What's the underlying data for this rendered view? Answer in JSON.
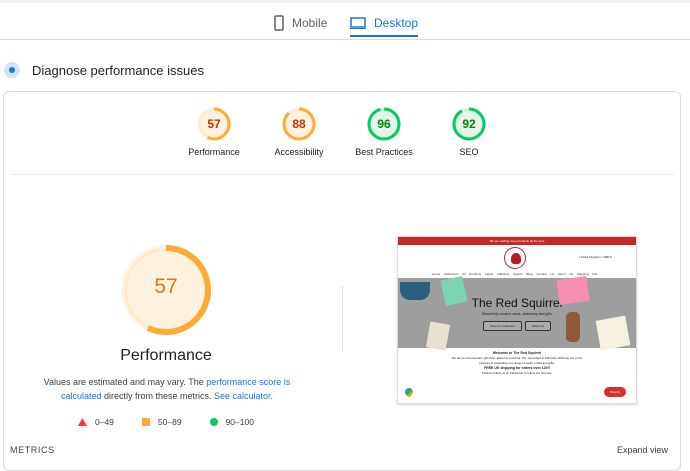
{
  "tabs": [
    {
      "label": "Mobile",
      "icon": "phone-icon"
    },
    {
      "label": "Desktop",
      "icon": "laptop-icon",
      "active": true
    }
  ],
  "diagnose_title": "Diagnose performance issues",
  "scores": [
    {
      "label": "Performance",
      "value": 57,
      "color": "#fa3"
    },
    {
      "label": "Accessibility",
      "value": 88,
      "color": "#fa3"
    },
    {
      "label": "Best Practices",
      "value": 96,
      "color": "#0c6"
    },
    {
      "label": "SEO",
      "value": 92,
      "color": "#0c6"
    }
  ],
  "main_score": {
    "value": "57",
    "title": "Performance"
  },
  "note": {
    "pre": "Values are estimated and may vary. The ",
    "link1": "performance score is calculated",
    "mid": " directly from these metrics. ",
    "link2": "See calculator."
  },
  "legend": [
    {
      "range": "0–49",
      "color": "#f33"
    },
    {
      "range": "50–89",
      "color": "#fa3"
    },
    {
      "range": "90–100",
      "color": "#0c6"
    }
  ],
  "screenshot": {
    "banner": "We are adding more products all the time",
    "currency": "United Kingdom | GBP £",
    "nav": "Home Collections All Products Latest Additions Search Blog Contact Us About Us Shipping Info",
    "hero_title": "The Red Squirrel",
    "hero_sub": "Beautifully curated cards, stationery and gifts",
    "btn1": "Shop by Collection",
    "btn2": "About Us",
    "welcome": "Welcome to The Red Squirrel",
    "desc": "We are a contemporary gift shop, based in Cumbria, UK. Launched in February 2023 we are in the process of expanding our range of cards, crafts and gifts.",
    "shipping": "FREE UK shipping for orders over £20!!",
    "follow": "Please Follow us on Facebook to follow our Journey",
    "chat": "Shopify"
  },
  "metrics_label": "METRICS",
  "expand_label": "Expand view"
}
